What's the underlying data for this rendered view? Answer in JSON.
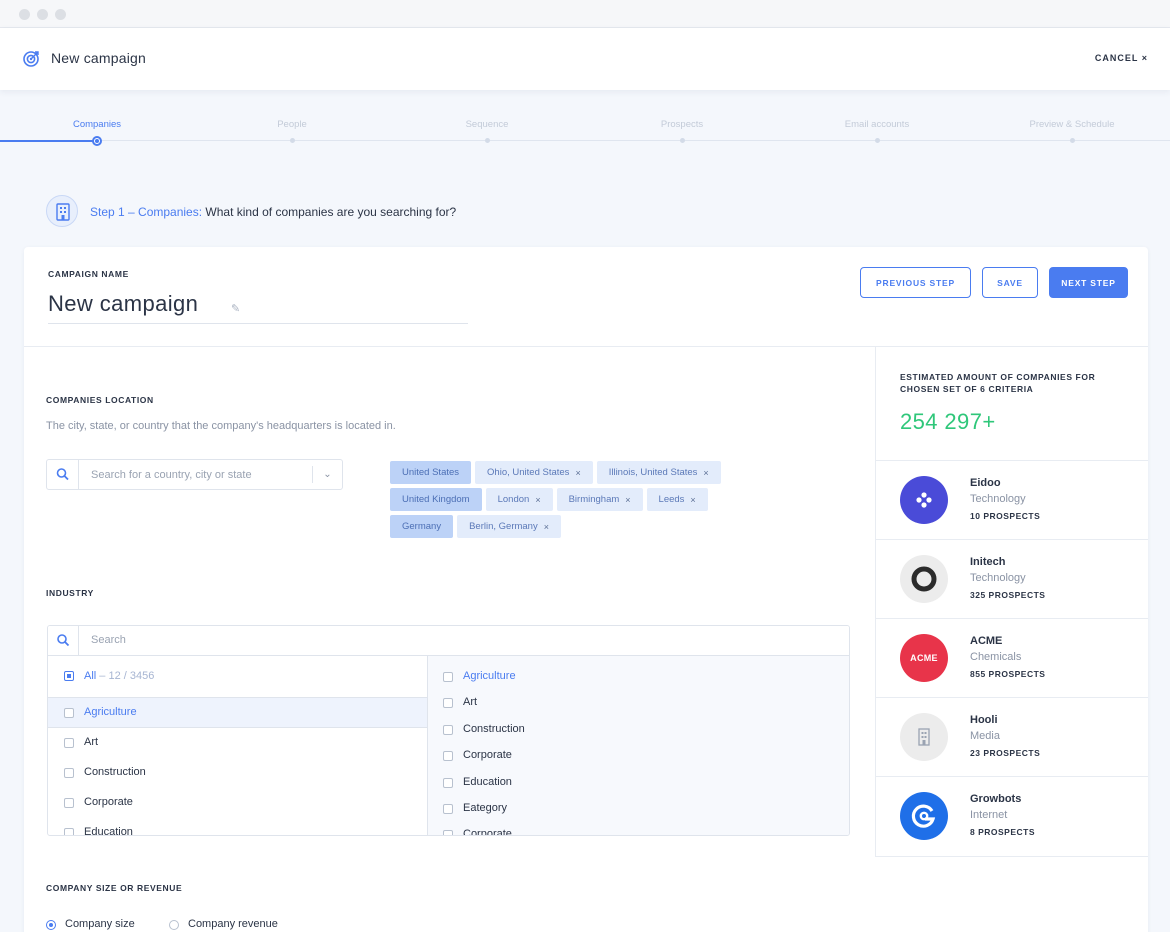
{
  "topbar": {
    "title": "New campaign",
    "cancel_label": "CANCEL ×"
  },
  "steps": [
    "Companies",
    "People",
    "Sequence",
    "Prospects",
    "Email accounts",
    "Preview & Schedule"
  ],
  "step_intro": {
    "step": "Step 1 – Companies:",
    "question": " What kind of companies are you searching for?"
  },
  "campaign": {
    "name_label": "CAMPAIGN NAME",
    "name": "New campaign"
  },
  "buttons": {
    "previous": "PREVIOUS STEP",
    "save": "SAVE",
    "next": "NEXT STEP"
  },
  "location": {
    "label": "COMPANIES LOCATION",
    "description": "The city, state, or country that the company's headquarters is located in.",
    "placeholder": "Search for a country, city or state",
    "tags": [
      [
        "United States",
        "Ohio, United States",
        "Illinois, United States"
      ],
      [
        "United Kingdom",
        "London",
        "Birmingham",
        "Leeds"
      ],
      [
        "Germany",
        "Berlin, Germany"
      ]
    ]
  },
  "industry": {
    "label": "INDUSTRY",
    "placeholder": "Search",
    "all_label": "All",
    "all_count": " – 12 / 3456",
    "col1": [
      "Agriculture",
      "Art",
      "Construction",
      "Corporate",
      "Education"
    ],
    "col2": [
      "Agriculture",
      "Art",
      "Construction",
      "Corporate",
      "Education",
      "Eategory",
      "Corporate"
    ]
  },
  "size": {
    "label": "COMPANY SIZE OR REVENUE",
    "option1": "Company size",
    "option2": "Company revenue"
  },
  "estimate": {
    "label": "ESTIMATED AMOUNT OF COMPANIES FOR CHOSEN SET OF 6 CRITERIA",
    "value": "254 297+"
  },
  "companies": [
    {
      "name": "Eidoo",
      "industry": "Technology",
      "prospects": "10 PROSPECTS",
      "color": "#4a4bd8"
    },
    {
      "name": "Initech",
      "industry": "Technology",
      "prospects": "325 PROSPECTS",
      "color": "#ececec"
    },
    {
      "name": "ACME",
      "industry": "Chemicals",
      "prospects": "855 PROSPECTS",
      "color": "#e8344a",
      "logo_text": "ACME"
    },
    {
      "name": "Hooli",
      "industry": "Media",
      "prospects": "23 PROSPECTS",
      "color": "#ececec"
    },
    {
      "name": "Growbots",
      "industry": "Internet",
      "prospects": "8 PROSPECTS",
      "color": "#1f6fe8"
    }
  ]
}
